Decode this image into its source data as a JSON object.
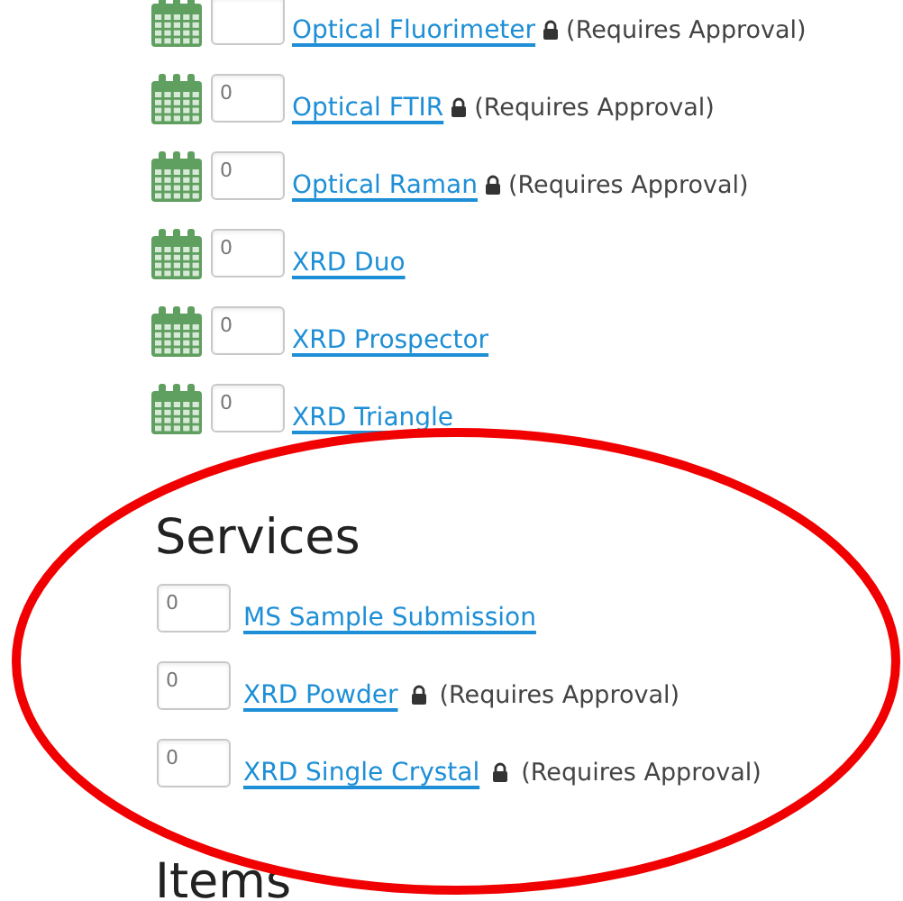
{
  "instruments": [
    {
      "name": "Optical Fluorimeter",
      "requires_approval": true,
      "approval_note": "(Requires Approval)"
    },
    {
      "name": "Optical FTIR",
      "quantity": "0",
      "requires_approval": true,
      "approval_note": "(Requires Approval)"
    },
    {
      "name": "Optical Raman",
      "quantity": "0",
      "requires_approval": true,
      "approval_note": "(Requires Approval)"
    },
    {
      "name": "XRD Duo",
      "quantity": "0",
      "requires_approval": false
    },
    {
      "name": "XRD Prospector",
      "quantity": "0",
      "requires_approval": false
    },
    {
      "name": "XRD Triangle",
      "quantity": "0",
      "requires_approval": false
    }
  ],
  "services": {
    "heading": "Services",
    "items": [
      {
        "name": "MS Sample Submission",
        "quantity": "0",
        "requires_approval": false
      },
      {
        "name": "XRD Powder",
        "quantity": "0",
        "requires_approval": true,
        "approval_note": "(Requires Approval)"
      },
      {
        "name": "XRD Single Crystal",
        "quantity": "0",
        "requires_approval": true,
        "approval_note": "(Requires Approval)"
      }
    ]
  },
  "items_section": {
    "heading": "Items"
  },
  "annotation": {
    "kind": "ellipse"
  }
}
